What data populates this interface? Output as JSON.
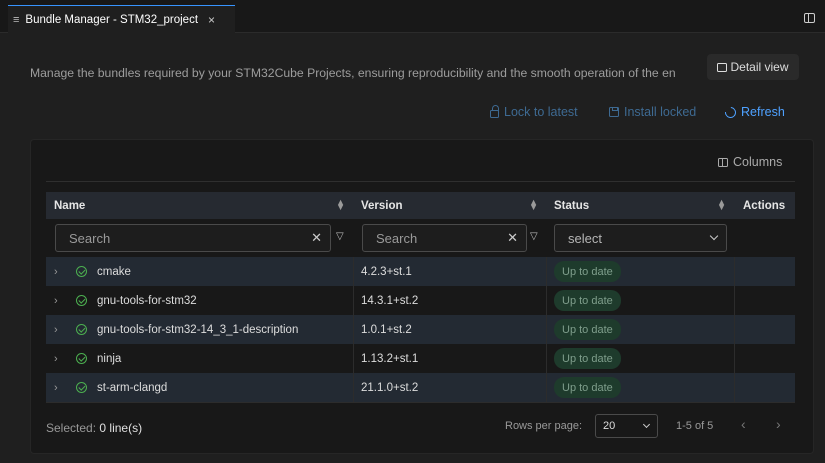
{
  "tab": {
    "title": "Bundle Manager - STM32_project",
    "icon": "menu-lines-icon",
    "close": "×"
  },
  "description": "Manage the bundles required by your STM32Cube Projects, ensuring reproducibility and the smooth operation of the en",
  "detail_view": "Detail view",
  "actions": {
    "lock": "Lock to latest",
    "install": "Install locked",
    "refresh": "Refresh"
  },
  "columns_label": "Columns",
  "table": {
    "headers": {
      "name": "Name",
      "version": "Version",
      "status": "Status",
      "actions": "Actions"
    },
    "filters": {
      "name_placeholder": "Search",
      "version_placeholder": "Search",
      "status_placeholder": "select"
    },
    "rows": [
      {
        "name": "cmake",
        "version": "4.2.3+st.1",
        "status": "Up to date"
      },
      {
        "name": "gnu-tools-for-stm32",
        "version": "14.3.1+st.2",
        "status": "Up to date"
      },
      {
        "name": "gnu-tools-for-stm32-14_3_1-description",
        "version": "1.0.1+st.2",
        "status": "Up to date"
      },
      {
        "name": "ninja",
        "version": "1.13.2+st.1",
        "status": "Up to date"
      },
      {
        "name": "st-arm-clangd",
        "version": "21.1.0+st.2",
        "status": "Up to date"
      }
    ]
  },
  "footer": {
    "selected_label": "Selected:",
    "selected_count": "0 line(s)",
    "rows_per_page_label": "Rows per page:",
    "rows_per_page_value": "20",
    "range": "1-5 of 5"
  },
  "colors": {
    "accent": "#4ea1ff",
    "success": "#4caf50",
    "row_alt": "#232a33",
    "header_bg": "#262a31"
  }
}
